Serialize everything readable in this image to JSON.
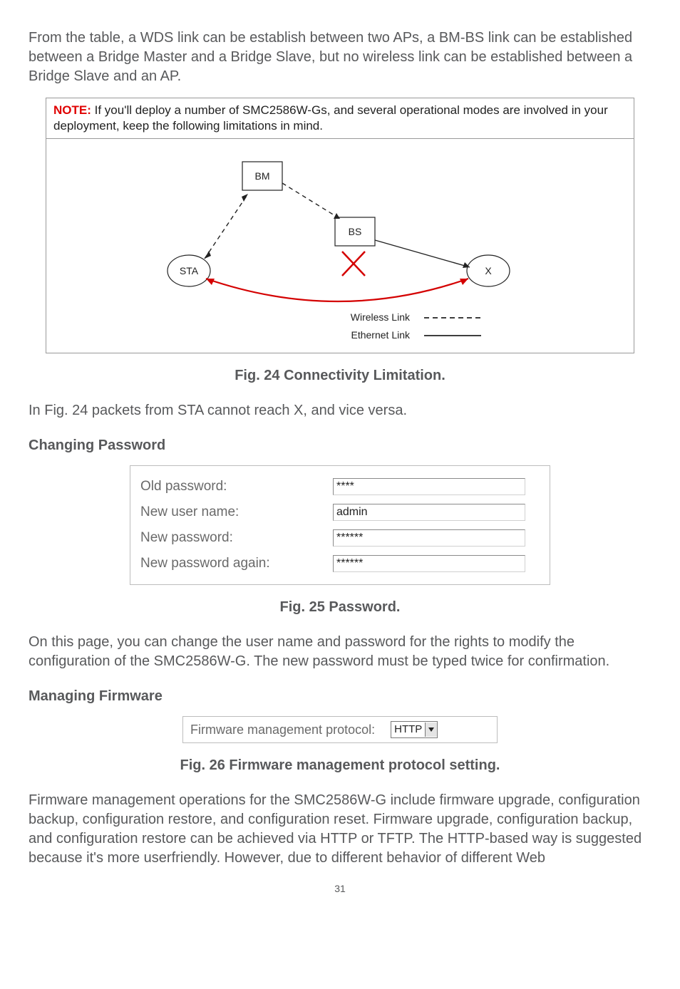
{
  "intro": "From the table, a WDS link can be establish between two APs, a BM-BS link can be established between a Bridge Master and a Bridge Slave, but no wireless link can be established between a Bridge Slave and an AP.",
  "note": {
    "label": "NOTE:",
    "text": " If you'll deploy a number of SMC2586W-Gs, and several operational modes are involved in your deployment, keep the following limitations in mind."
  },
  "diagram": {
    "bm": "BM",
    "bs": "BS",
    "sta": "STA",
    "x": "X",
    "wireless": "Wireless Link",
    "ethernet": "Ethernet Link"
  },
  "fig24_caption": "Fig. 24 Connectivity Limitation.",
  "fig24_para": "In Fig. 24 packets from STA cannot reach X, and vice versa.",
  "heading_password": "Changing Password",
  "pwd": {
    "old_label": "Old password:",
    "old_value": "****",
    "user_label": "New user name:",
    "user_value": "admin",
    "new_label": "New password:",
    "new_value": "******",
    "again_label": "New password again:",
    "again_value": "******"
  },
  "fig25_caption": "Fig. 25 Password.",
  "pwd_para": "On this page, you can change the user name and password for the rights to modify the configuration of the SMC2586W-G. The new password must be typed twice for confirmation.",
  "heading_firmware": "Managing Firmware",
  "fw": {
    "label": "Firmware management protocol:",
    "value": "HTTP"
  },
  "fig26_caption": "Fig. 26 Firmware management protocol setting.",
  "fw_para": "Firmware management operations for the SMC2586W-G include firmware upgrade, configuration backup, configuration restore, and configuration reset. Firmware upgrade, configuration backup, and configuration restore can be achieved via HTTP or TFTP. The HTTP-based way is suggested because it's more userfriendly. However, due to different behavior of different Web",
  "page_number": "31"
}
